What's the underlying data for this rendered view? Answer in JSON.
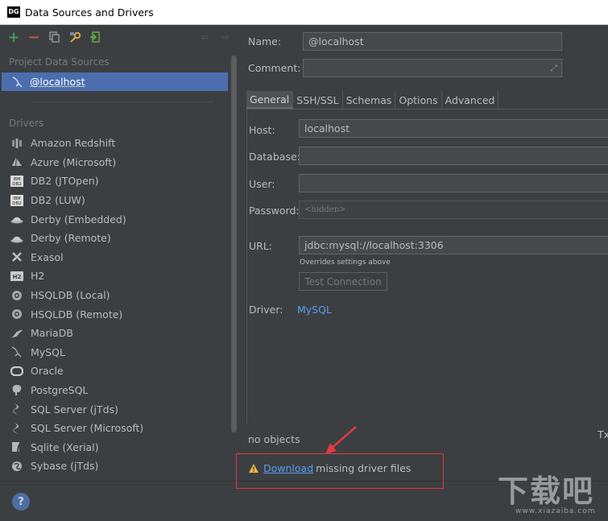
{
  "window": {
    "app_icon": "DG",
    "title": "Data Sources and Drivers"
  },
  "toolbar": {
    "add_icon": "plus-icon",
    "remove_icon": "minus-icon",
    "duplicate_icon": "copy-icon",
    "properties_icon": "wrench-icon",
    "import_icon": "import-icon",
    "back_icon": "arrow-left-icon",
    "forward_icon": "arrow-right-icon"
  },
  "sidebar": {
    "project_section": "Project Data Sources",
    "selected_source": "@localhost",
    "drivers_section": "Drivers",
    "drivers": [
      {
        "label": "Amazon Redshift",
        "icon": "redshift-icon"
      },
      {
        "label": "Azure (Microsoft)",
        "icon": "azure-icon"
      },
      {
        "label": "DB2 (JTOpen)",
        "icon": "ibm-db2-icon"
      },
      {
        "label": "DB2 (LUW)",
        "icon": "ibm-db2-icon"
      },
      {
        "label": "Derby (Embedded)",
        "icon": "derby-hat-icon"
      },
      {
        "label": "Derby (Remote)",
        "icon": "derby-hat-icon"
      },
      {
        "label": "Exasol",
        "icon": "exasol-x-icon"
      },
      {
        "label": "H2",
        "icon": "h2-icon"
      },
      {
        "label": "HSQLDB (Local)",
        "icon": "hsqldb-icon"
      },
      {
        "label": "HSQLDB (Remote)",
        "icon": "hsqldb-icon"
      },
      {
        "label": "MariaDB",
        "icon": "mariadb-seal-icon"
      },
      {
        "label": "MySQL",
        "icon": "mysql-dolphin-icon"
      },
      {
        "label": "Oracle",
        "icon": "oracle-icon"
      },
      {
        "label": "PostgreSQL",
        "icon": "postgresql-elephant-icon"
      },
      {
        "label": "SQL Server (jTds)",
        "icon": "sqlserver-icon"
      },
      {
        "label": "SQL Server (Microsoft)",
        "icon": "sqlserver-icon"
      },
      {
        "label": "Sqlite (Xerial)",
        "icon": "sqlite-icon"
      },
      {
        "label": "Sybase (jTds)",
        "icon": "sybase-icon"
      }
    ]
  },
  "form": {
    "name_label": "Name:",
    "name_value": "@localhost",
    "comment_label": "Comment:",
    "comment_value": "",
    "tabs": [
      "General",
      "SSH/SSL",
      "Schemas",
      "Options",
      "Advanced"
    ],
    "active_tab": "General",
    "host_label": "Host:",
    "host_value": "localhost",
    "database_label": "Database:",
    "database_value": "",
    "user_label": "User:",
    "user_value": "",
    "password_label": "Password:",
    "password_placeholder": "<hidden>",
    "url_label": "URL:",
    "url_value": "jdbc:mysql://localhost:3306",
    "url_hint": "Overrides settings above",
    "test_button": "Test Connection",
    "driver_label": "Driver:",
    "driver_value": "MySQL",
    "objects_status": "no objects",
    "truncated_right": "Tx"
  },
  "warning": {
    "icon": "warning-triangle-icon",
    "link": "Download",
    "text": "missing driver files"
  },
  "footer": {
    "help_label": "?"
  },
  "watermark": {
    "text": "下载吧",
    "url": "www.xiazaiba.com"
  },
  "colors": {
    "background": "#3c3f41",
    "selection": "#4b6eaf",
    "link": "#589df6",
    "annotation_red": "#e0393e",
    "add_green": "#499c54",
    "remove_red": "#c75450"
  }
}
